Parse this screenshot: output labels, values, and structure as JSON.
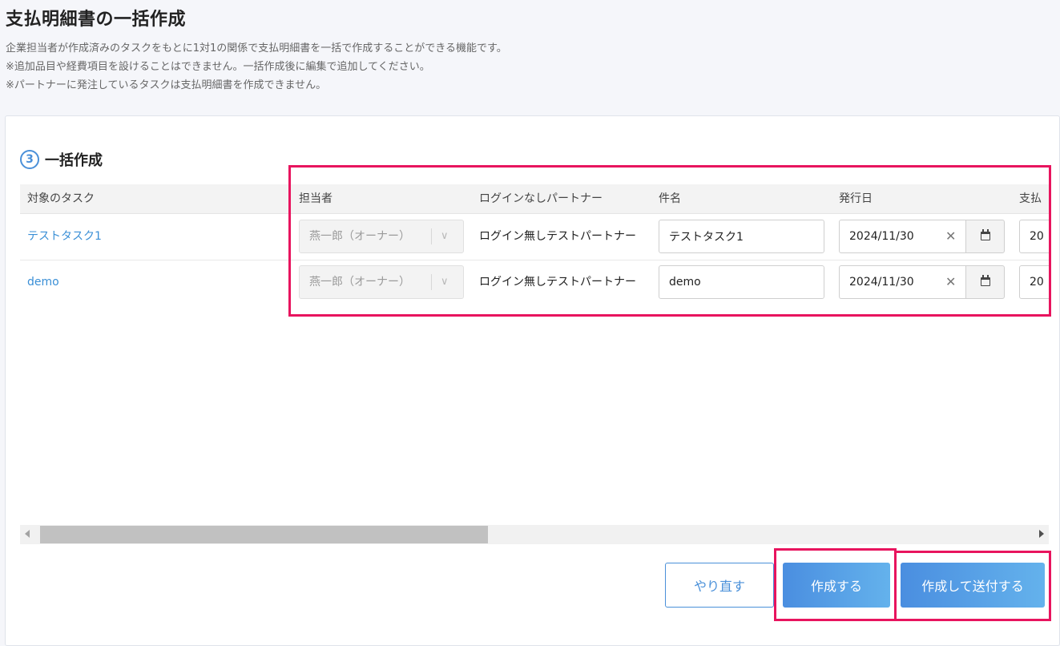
{
  "page": {
    "title": "支払明細書の一括作成",
    "descriptions": [
      "企業担当者が作成済みのタスクをもとに1対1の関係で支払明細書を一括で作成することができる機能です。",
      "※追加品目や経費項目を設けることはできません。一括作成後に編集で追加してください。",
      "※パートナーに発注しているタスクは支払明細書を作成できません。"
    ]
  },
  "section": {
    "step": "3",
    "title": "一括作成"
  },
  "table": {
    "columns": {
      "task": "対象のタスク",
      "assignee": "担当者",
      "partner": "ログインなしパートナー",
      "subject": "件名",
      "issue_date": "発行日",
      "payment": "支払"
    },
    "rows": [
      {
        "task": "テストタスク1",
        "assignee": "燕一郎（オーナー）",
        "partner": "ログイン無しテストパートナー",
        "subject": "テストタスク1",
        "issue_date": "2024/11/30",
        "payment": "20"
      },
      {
        "task": "demo",
        "assignee": "燕一郎（オーナー）",
        "partner": "ログイン無しテストパートナー",
        "subject": "demo",
        "issue_date": "2024/11/30",
        "payment": "20"
      }
    ]
  },
  "actions": {
    "redo": "やり直す",
    "create": "作成する",
    "create_send": "作成して送付する"
  },
  "icons": {
    "clear": "close-icon",
    "calendar": "calendar-icon",
    "select": "chevron-down-icon"
  },
  "colors": {
    "accent": "#4a90d9",
    "link": "#3a8fd6",
    "highlight": "#e8145e",
    "primary_gradient_start": "#4a8ee0",
    "primary_gradient_end": "#64b2ec"
  }
}
